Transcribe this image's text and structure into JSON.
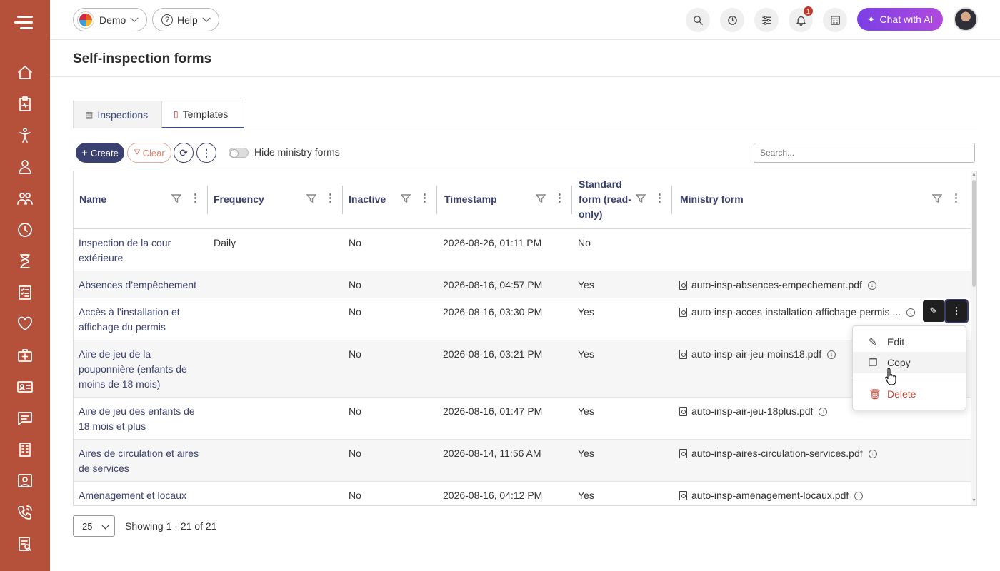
{
  "topbar": {
    "org_label": "Demo",
    "help_label": "Help",
    "notification_count": "1",
    "ai_button_label": "Chat with AI"
  },
  "page": {
    "title": "Self-inspection forms"
  },
  "tabs": [
    {
      "label": "Inspections",
      "icon": "form-icon",
      "active": false
    },
    {
      "label": "Templates",
      "icon": "pdf-icon",
      "active": true
    }
  ],
  "toolbar": {
    "create_label": "Create",
    "clear_label": "Clear",
    "toggle_label": "Hide ministry forms",
    "search_placeholder": "Search..."
  },
  "table": {
    "columns": [
      "Name",
      "Frequency",
      "Inactive",
      "Timestamp",
      "Standard form (read-only)",
      "Ministry form"
    ],
    "rows": [
      {
        "name": "Inspection de la cour extérieure",
        "frequency": "Daily",
        "inactive": "No",
        "timestamp": "2026-08-26, 01:11 PM",
        "standard": "No",
        "ministry": ""
      },
      {
        "name": "Absences d’empêchement",
        "frequency": "",
        "inactive": "No",
        "timestamp": "2026-08-16, 04:57 PM",
        "standard": "Yes",
        "ministry": "auto-insp-absences-empechement.pdf"
      },
      {
        "name": "Accès à l’installation et affichage du permis",
        "frequency": "",
        "inactive": "No",
        "timestamp": "2026-08-16, 03:30 PM",
        "standard": "Yes",
        "ministry": "auto-insp-acces-installation-affichage-permis...."
      },
      {
        "name": "Aire de jeu de la pouponnière (enfants de moins de 18 mois)",
        "frequency": "",
        "inactive": "No",
        "timestamp": "2026-08-16, 03:21 PM",
        "standard": "Yes",
        "ministry": "auto-insp-air-jeu-moins18.pdf"
      },
      {
        "name": "Aire de jeu des enfants de 18 mois et plus",
        "frequency": "",
        "inactive": "No",
        "timestamp": "2026-08-16, 01:47 PM",
        "standard": "Yes",
        "ministry": "auto-insp-air-jeu-18plus.pdf"
      },
      {
        "name": "Aires de circulation et aires de services",
        "frequency": "",
        "inactive": "No",
        "timestamp": "2026-08-14, 11:56 AM",
        "standard": "Yes",
        "ministry": "auto-insp-aires-circulation-services.pdf"
      },
      {
        "name": "Aménagement et locaux",
        "frequency": "",
        "inactive": "No",
        "timestamp": "2026-08-16, 04:12 PM",
        "standard": "Yes",
        "ministry": "auto-insp-amenagement-locaux.pdf"
      }
    ]
  },
  "context_menu": {
    "edit_label": "Edit",
    "copy_label": "Copy",
    "delete_label": "Delete"
  },
  "footer": {
    "page_size": "25",
    "showing": "Showing 1 - 21 of 21"
  },
  "sidebar": {
    "items": [
      "home-icon",
      "clipboard-icon",
      "child-icon",
      "staff-icon",
      "group-icon",
      "clock-icon",
      "hourglass-icon",
      "checklist-icon",
      "heart-icon",
      "medkit-icon",
      "id-card-icon",
      "chat-icon",
      "building-icon",
      "contact-icon",
      "phone-icon",
      "report-icon"
    ]
  },
  "colors": {
    "sidebar": "#b5503b",
    "primary": "#3a4170",
    "ai_gradient_start": "#7b3fe4",
    "ai_gradient_end": "#b14adf",
    "danger": "#c24a3a"
  }
}
